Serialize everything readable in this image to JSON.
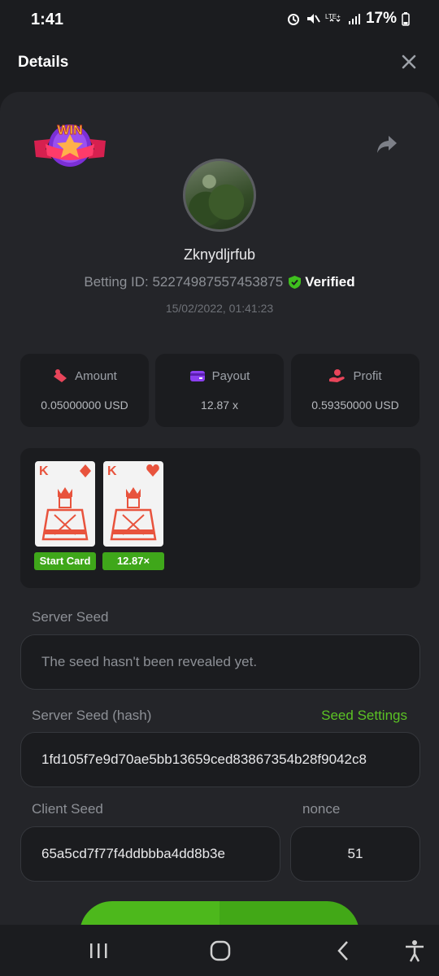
{
  "status": {
    "time": "1:41",
    "battery": "17%",
    "icons": [
      "alarm-icon",
      "mute-icon",
      "lte-icon",
      "signal-icon",
      "battery-icon"
    ]
  },
  "header": {
    "title": "Details",
    "close_icon": "close-icon"
  },
  "win_badge": {
    "text": "WIN"
  },
  "user": {
    "name": "Zknydljrfub",
    "betting_id": "Betting ID: 52274987557453875",
    "verified_label": "Verified",
    "date": "15/02/2022, 01:41:23"
  },
  "stats": [
    {
      "label": "Amount",
      "value": "0.05000000 USD",
      "icon": "amount-icon",
      "color": "#e8455a"
    },
    {
      "label": "Payout",
      "value": "12.87 x",
      "icon": "wallet-icon",
      "color": "#8b3ff0"
    },
    {
      "label": "Profit",
      "value": "0.59350000 USD",
      "icon": "profit-icon",
      "color": "#e8455a"
    }
  ],
  "cards": [
    {
      "rank": "K",
      "suit": "diamond",
      "tag": "Start Card"
    },
    {
      "rank": "K",
      "suit": "heart",
      "tag": "12.87×"
    }
  ],
  "server_seed": {
    "label": "Server Seed",
    "value": "The seed hasn't been revealed yet."
  },
  "server_seed_hash": {
    "label": "Server Seed (hash)",
    "link": "Seed Settings",
    "value": "1fd105f7e9d70ae5bb13659ced83867354b28f9042c8"
  },
  "client_seed": {
    "label": "Client Seed",
    "value": "65a5cd7f77f4ddbbba4dd8b3e"
  },
  "nonce": {
    "label": "nonce",
    "value": "51"
  },
  "colors": {
    "accent_green": "#5bc224",
    "background": "#1b1c1f",
    "panel": "#242529"
  }
}
